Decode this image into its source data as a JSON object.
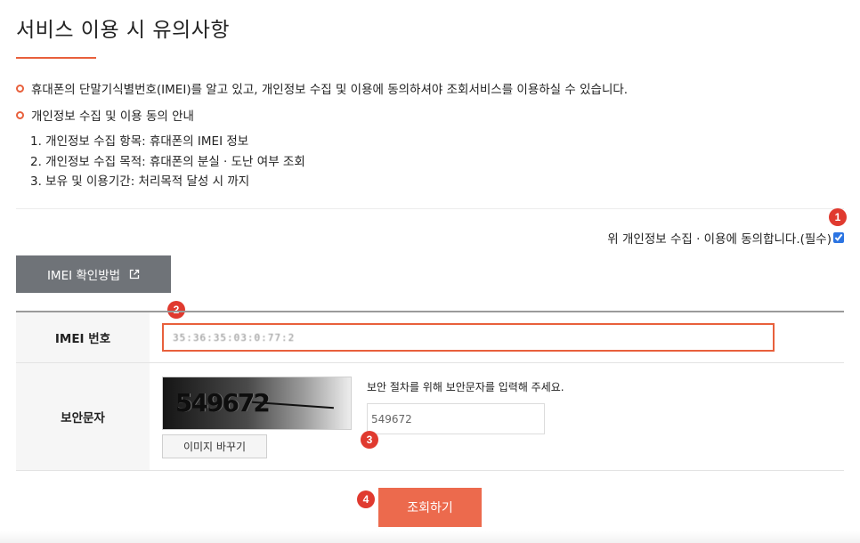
{
  "page": {
    "title": "서비스 이용 시 유의사항"
  },
  "notice": {
    "bullet1": "휴대폰의 단말기식별번호(IMEI)를 알고 있고, 개인정보 수집 및 이용에 동의하셔야 조회서비스를 이용하실 수 있습니다.",
    "bullet2": "개인정보 수집 및 이용 동의 안내",
    "items": [
      "1. 개인정보 수집 항목: 휴대폰의 IMEI 정보",
      "2. 개인정보 수집 목적: 휴대폰의 분실 · 도난 여부 조회",
      "3. 보유 및 이용기간: 처리목적 달성 시 까지"
    ]
  },
  "consent": {
    "label": "위 개인정보 수집 · 이용에 동의합니다.(필수)",
    "checked": true
  },
  "imei_guide_button": {
    "label": "IMEI 확인방법",
    "icon": "external-link-icon"
  },
  "form": {
    "imei": {
      "label": "IMEI 번호",
      "value": "35:36:35:03:0:77:2"
    },
    "security": {
      "label": "보안문자",
      "captcha_text": "549672",
      "change_image_label": "이미지 바꾸기",
      "hint": "보안 절차를 위해 보안문자를 입력해 주세요.",
      "value": "549672"
    }
  },
  "submit": {
    "label": "조회하기"
  },
  "badges": [
    "1",
    "2",
    "3",
    "4"
  ],
  "colors": {
    "accent": "#e8603c",
    "badge": "#e03a2f",
    "submit": "#ec6a4d",
    "guide_button": "#6f7378"
  }
}
